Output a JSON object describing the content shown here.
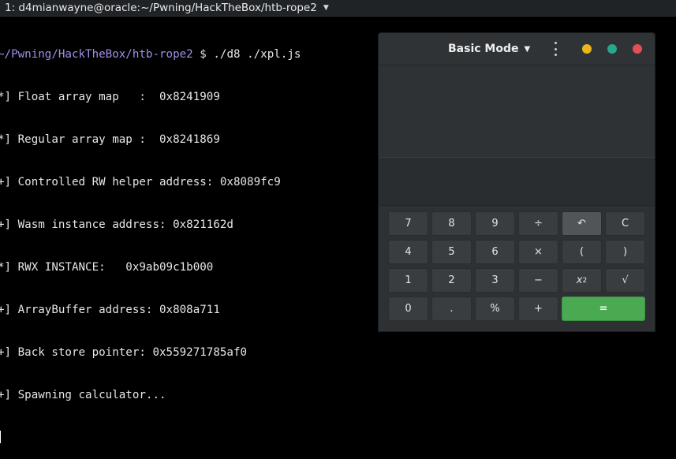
{
  "terminal_tab": {
    "title": "1: d4mianwayne@oracle:~/Pwning/HackTheBox/htb-rope2"
  },
  "terminal": {
    "prompt_path": "~/Pwning/HackTheBox/htb-rope2",
    "prompt_symbol": "$",
    "command": "./d8 ./xpl.js",
    "lines": [
      "*] Float array map   :  0x8241909",
      "*] Regular array map :  0x8241869",
      "+] Controlled RW helper address: 0x8089fc9",
      "+] Wasm instance address: 0x821162d",
      "*] RWX INSTANCE:   0x9ab09c1b000",
      "+] ArrayBuffer address: 0x808a711",
      "+] Back store pointer: 0x559271785af0",
      "+] Spawning calculator..."
    ]
  },
  "calculator": {
    "mode_label": "Basic Mode",
    "colors": {
      "minimize": "#e8b61d",
      "maximize": "#27a88b",
      "close": "#e24f53",
      "equals": "#4aaa51"
    },
    "keys": {
      "k7": "7",
      "k8": "8",
      "k9": "9",
      "divide": "÷",
      "undo": "↶",
      "clear": "C",
      "k4": "4",
      "k5": "5",
      "k6": "6",
      "multiply": "×",
      "lparen": "(",
      "rparen": ")",
      "k1": "1",
      "k2": "2",
      "k3": "3",
      "minus": "−",
      "square_base": "x",
      "square_exp": "2",
      "sqrt": "√",
      "k0": "0",
      "decimal": ".",
      "percent": "%",
      "plus": "+",
      "equals": "="
    }
  }
}
